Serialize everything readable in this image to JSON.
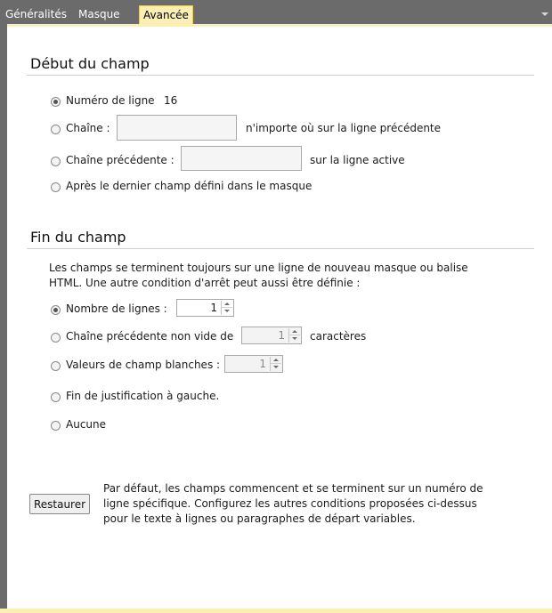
{
  "tabs": [
    {
      "label": "Généralités",
      "active": false
    },
    {
      "label": "Masque",
      "active": false
    },
    {
      "label": "Avancée",
      "active": true
    }
  ],
  "start_section": {
    "title": "Début du champ",
    "line_number": {
      "label": "Numéro de ligne",
      "value": "16",
      "checked": true
    },
    "string": {
      "label": "Chaîne :",
      "value": "",
      "suffix": "n'importe où sur la ligne précédente",
      "checked": false
    },
    "preceding_string": {
      "label": "Chaîne précédente :",
      "value": "",
      "suffix": "sur la ligne active",
      "checked": false
    },
    "after_last": {
      "label": "Après le dernier champ défini dans le masque",
      "checked": false
    }
  },
  "end_section": {
    "title": "Fin du champ",
    "description_line1": "Les champs se terminent toujours sur une ligne de nouveau masque ou balise",
    "description_line2": "HTML.  Une autre condition d'arrêt peut aussi être définie :",
    "line_count": {
      "label": "Nombre de lignes :",
      "value": "1",
      "checked": true
    },
    "non_empty_preceding": {
      "label": "Chaîne précédente non vide de",
      "value": "1",
      "suffix": "caractères",
      "checked": false
    },
    "blank_values": {
      "label": "Valeurs de champ blanches :",
      "value": "1",
      "checked": false
    },
    "left_justify": {
      "label": "Fin de justification à gauche.",
      "checked": false
    },
    "none": {
      "label": "Aucune",
      "checked": false
    }
  },
  "restore": {
    "button_label": "Restaurer",
    "help_line1": "Par défaut, les champs commencent et se terminent sur un numéro de",
    "help_line2": "ligne spécifique.  Configurez les autres conditions proposées ci-dessus",
    "help_line3": "pour le texte à lignes ou paragraphes de départ variables."
  },
  "colors": {
    "tab_strip": "#6b6b6b",
    "active_tab": "#fcefb4",
    "accent_band": "#fcefb4"
  }
}
